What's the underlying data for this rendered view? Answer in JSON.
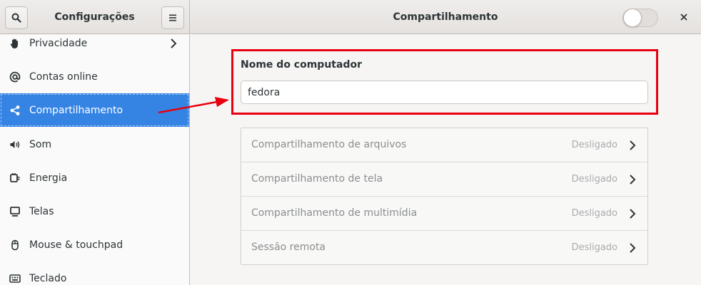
{
  "header": {
    "sidebar_title": "Configurações",
    "panel_title": "Compartilhamento",
    "sharing_switch_on": false
  },
  "sidebar": {
    "items": [
      {
        "label": "Privacidade",
        "icon": "hand-icon",
        "has_chevron": true
      },
      {
        "label": "Contas online",
        "icon": "at-sign-icon"
      },
      {
        "label": "Compartilhamento",
        "icon": "share-icon",
        "active": true
      },
      {
        "label": "Som",
        "icon": "speaker-icon"
      },
      {
        "label": "Energia",
        "icon": "power-plug-icon"
      },
      {
        "label": "Telas",
        "icon": "display-icon"
      },
      {
        "label": "Mouse & touchpad",
        "icon": "mouse-icon"
      },
      {
        "label": "Teclado",
        "icon": "keyboard-icon"
      }
    ]
  },
  "main": {
    "computer_name_label": "Nome do computador",
    "computer_name_value": "fedora",
    "sharing_rows": [
      {
        "label": "Compartilhamento de arquivos",
        "status": "Desligado"
      },
      {
        "label": "Compartilhamento de tela",
        "status": "Desligado"
      },
      {
        "label": "Compartilhamento de multimídia",
        "status": "Desligado"
      },
      {
        "label": "Sessão remota",
        "status": "Desligado"
      }
    ]
  },
  "annotation": {
    "highlight_color": "#e8000f",
    "accent_color": "#3584e4"
  }
}
